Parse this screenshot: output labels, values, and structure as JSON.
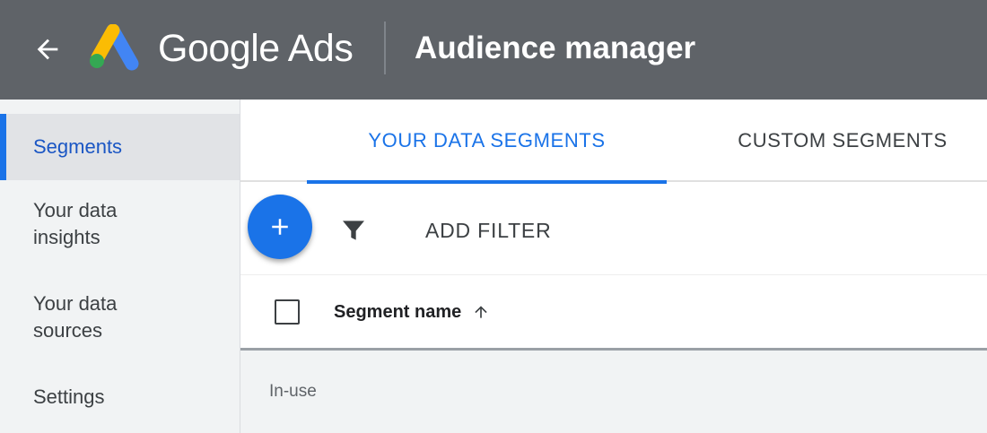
{
  "header": {
    "product_name": "Google Ads",
    "page_title": "Audience manager",
    "back_icon": "arrow-back-icon",
    "logo_colors": {
      "blue": "#4285f4",
      "yellow": "#fbbc04",
      "green": "#34a853"
    },
    "background": "#5f6368"
  },
  "sidebar": {
    "items": [
      {
        "label": "Segments",
        "active": true
      },
      {
        "label": "Your data insights",
        "active": false
      },
      {
        "label": "Your data sources",
        "active": false
      },
      {
        "label": "Settings",
        "active": false
      }
    ]
  },
  "tabs": [
    {
      "label": "YOUR DATA SEGMENTS",
      "active": true
    },
    {
      "label": "CUSTOM SEGMENTS",
      "active": false
    }
  ],
  "toolbar": {
    "add_icon": "plus-icon",
    "filter_icon": "filter-funnel-icon",
    "add_filter_label": "ADD FILTER"
  },
  "table": {
    "columns": [
      {
        "label": "Segment name",
        "sort": "ascending",
        "sort_icon": "arrow-up-icon"
      }
    ],
    "groups": [
      {
        "label": "In-use"
      }
    ]
  },
  "colors": {
    "accent": "#1a73e8"
  }
}
